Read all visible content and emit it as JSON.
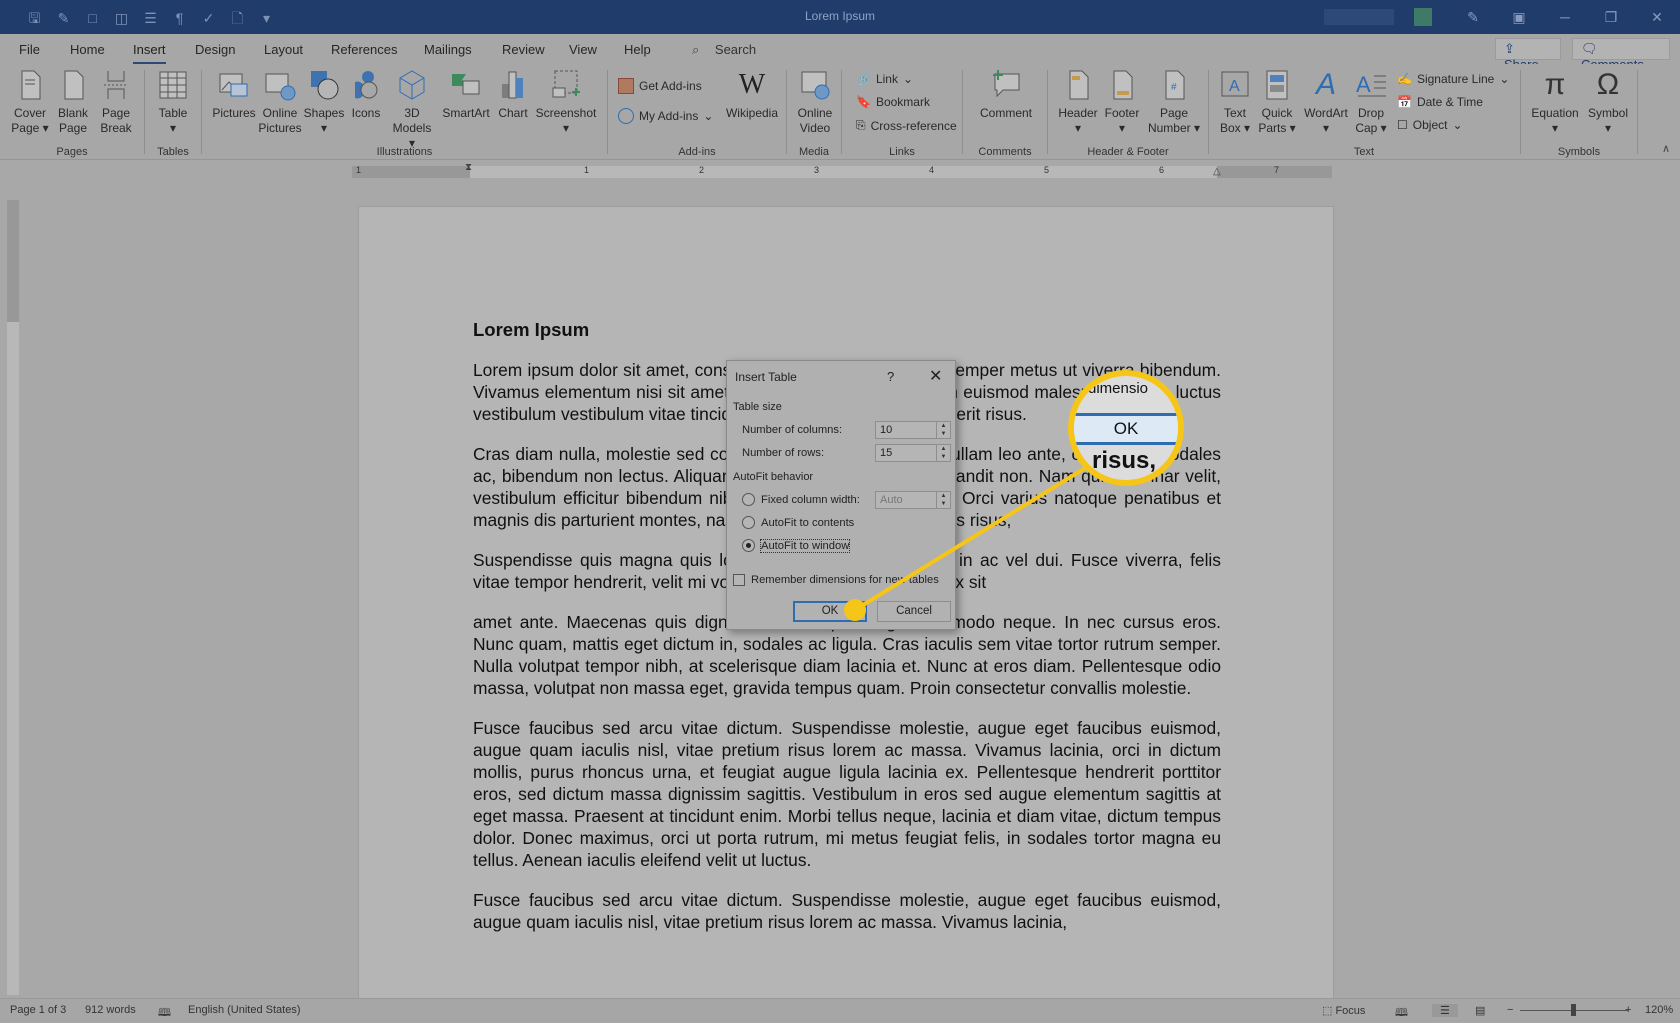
{
  "window": {
    "title": "Lorem Ipsum",
    "quick_access": [
      "save-icon",
      "save-as-icon",
      "open-folder-icon",
      "layout-icon",
      "table-icon",
      "pilcrow-icon",
      "spelling-icon",
      "new-document-icon",
      "customize-qat-icon"
    ],
    "controls": {
      "minimize": "─",
      "restore": "❐",
      "close": "✕"
    }
  },
  "menu": {
    "tabs": [
      "File",
      "Home",
      "Insert",
      "Design",
      "Layout",
      "References",
      "Mailings",
      "Review",
      "View",
      "Help"
    ],
    "active_tab": "Insert",
    "search_label": "Search",
    "share_label": "Share",
    "comments_label": "Comments"
  },
  "ribbon": {
    "groups": {
      "pages": {
        "label": "Pages",
        "buttons": [
          {
            "line1": "Cover",
            "line2": "Page ▾"
          },
          {
            "line1": "Blank",
            "line2": "Page"
          },
          {
            "line1": "Page",
            "line2": "Break"
          }
        ]
      },
      "tables": {
        "label": "Tables",
        "buttons": [
          {
            "line1": "Table",
            "line2": "▾"
          }
        ]
      },
      "illustrations": {
        "label": "Illustrations",
        "buttons": [
          {
            "line1": "Pictures",
            "line2": ""
          },
          {
            "line1": "Online",
            "line2": "Pictures"
          },
          {
            "line1": "Shapes",
            "line2": "▾"
          },
          {
            "line1": "Icons",
            "line2": ""
          },
          {
            "line1": "3D",
            "line2": "Models ▾"
          },
          {
            "line1": "SmartArt",
            "line2": ""
          },
          {
            "line1": "Chart",
            "line2": ""
          },
          {
            "line1": "Screenshot",
            "line2": "▾"
          }
        ]
      },
      "addins": {
        "label": "Add-ins",
        "get_addins": "Get Add-ins",
        "my_addins": "My Add-ins",
        "wikipedia": "Wikipedia"
      },
      "media": {
        "label": "Media",
        "buttons": [
          {
            "line1": "Online",
            "line2": "Video"
          }
        ]
      },
      "links": {
        "label": "Links",
        "link": "Link",
        "bookmark": "Bookmark",
        "cross_reference": "Cross-reference"
      },
      "comments": {
        "label": "Comments",
        "buttons": [
          {
            "line1": "Comment",
            "line2": ""
          }
        ]
      },
      "header_footer": {
        "label": "Header & Footer",
        "buttons": [
          {
            "line1": "Header",
            "line2": "▾"
          },
          {
            "line1": "Footer",
            "line2": "▾"
          },
          {
            "line1": "Page",
            "line2": "Number ▾"
          }
        ]
      },
      "text": {
        "label": "Text",
        "buttons": [
          {
            "line1": "Text",
            "line2": "Box ▾"
          },
          {
            "line1": "Quick",
            "line2": "Parts ▾"
          },
          {
            "line1": "WordArt",
            "line2": "▾"
          },
          {
            "line1": "Drop",
            "line2": "Cap ▾"
          }
        ],
        "signature_line": "Signature Line",
        "date_time": "Date & Time",
        "object": "Object"
      },
      "symbols": {
        "label": "Symbols",
        "buttons": [
          {
            "line1": "Equation",
            "line2": "▾"
          },
          {
            "line1": "Symbol",
            "line2": "▾"
          }
        ]
      }
    }
  },
  "ruler": {
    "numbers": [
      "1",
      "1",
      "2",
      "3",
      "4",
      "5",
      "6",
      "7"
    ],
    "tab_selector": "L"
  },
  "document": {
    "heading": "Lorem Ipsum",
    "paragraphs": [
      "Lorem ipsum dolor sit amet, consectetur adipiscing elit. Cras semper metus ut viverra bibendum. Vivamus elementum nisi sit amet. Aenean scelerisque aliquam euismod malesuada. Proin luctus vestibulum vestibulum vitae tincidunt, egestas magna in, hendrerit risus.",
      "Cras diam nulla, molestie sed commodo vitae, luctus nunc. Nullam leo ante, ornare sed sodales ac, bibendum non lectus. Aliquam ligula, non tristique turpis blandit non. Nam quis pulvinar velit, vestibulum efficitur bibendum nibh, ut mattis sem varius nec. Orci varius natoque penatibus et magnis dis parturient montes, nascetur ridiculus mus. In tempus risus,",
      "Suspendisse quis magna quis lorem ullamcorper fermentum in ac vel dui. Fusce viverra, felis vitae tempor hendrerit, velit mi volutpat risus, in hendrerit nisl ex sit",
      "amet ante. Maecenas quis dignissim ex. Aliquam eget commodo neque. In nec cursus eros. Nunc quam, mattis eget dictum in, sodales ac ligula. Cras iaculis sem vitae tortor rutrum semper. Nulla volutpat tempor nibh, at scelerisque diam lacinia et. Nunc at eros diam. Pellentesque odio massa, volutpat non massa eget, gravida tempus quam. Proin consectetur convallis molestie.",
      "Fusce faucibus sed arcu vitae dictum. Suspendisse molestie, augue eget faucibus euismod, augue quam iaculis nisl, vitae pretium risus lorem ac massa. Vivamus lacinia, orci in dictum mollis, purus rhoncus urna, et feugiat augue ligula lacinia ex. Pellentesque hendrerit porttitor eros, sed dictum massa dignissim sagittis. Vestibulum in eros sed augue elementum sagittis at eget massa. Praesent at tincidunt enim. Morbi tellus neque, lacinia et diam vitae, dictum tempus dolor. Donec maximus, orci ut porta rutrum, mi metus feugiat felis, in sodales tortor magna eu tellus. Aenean iaculis eleifend velit ut luctus.",
      "Fusce faucibus sed arcu vitae dictum. Suspendisse molestie, augue eget faucibus euismod, augue quam iaculis nisl, vitae pretium risus lorem ac massa. Vivamus lacinia,"
    ]
  },
  "dialog": {
    "title": "Insert Table",
    "help": "?",
    "close": "✕",
    "table_size_label": "Table size",
    "columns_label": "Number of columns:",
    "columns_value": "10",
    "rows_label": "Number of rows:",
    "rows_value": "15",
    "autofit_label": "AutoFit behavior",
    "options": [
      {
        "label": "Fixed column width:",
        "selected": false
      },
      {
        "label": "AutoFit to contents",
        "selected": false
      },
      {
        "label": "AutoFit to window",
        "selected": true
      }
    ],
    "fixed_width_value": "Auto",
    "remember_label": "Remember dimensions for new tables",
    "remember_checked": false,
    "ok_label": "OK",
    "cancel_label": "Cancel"
  },
  "callout": {
    "top_text": "dimensio",
    "ok_label": "OK",
    "bottom_text": "risus,",
    "color": "#f5c518"
  },
  "status": {
    "page": "Page 1 of 3",
    "words": "912 words",
    "language": "English (United States)",
    "focus": "Focus",
    "zoom_minus": "−",
    "zoom_plus": "+",
    "zoom_level": "120%",
    "zoom_percent": 120
  },
  "colors": {
    "titlebar": "#1f3c6b",
    "accent": "#2f6db2",
    "highlight": "#f5c518"
  }
}
